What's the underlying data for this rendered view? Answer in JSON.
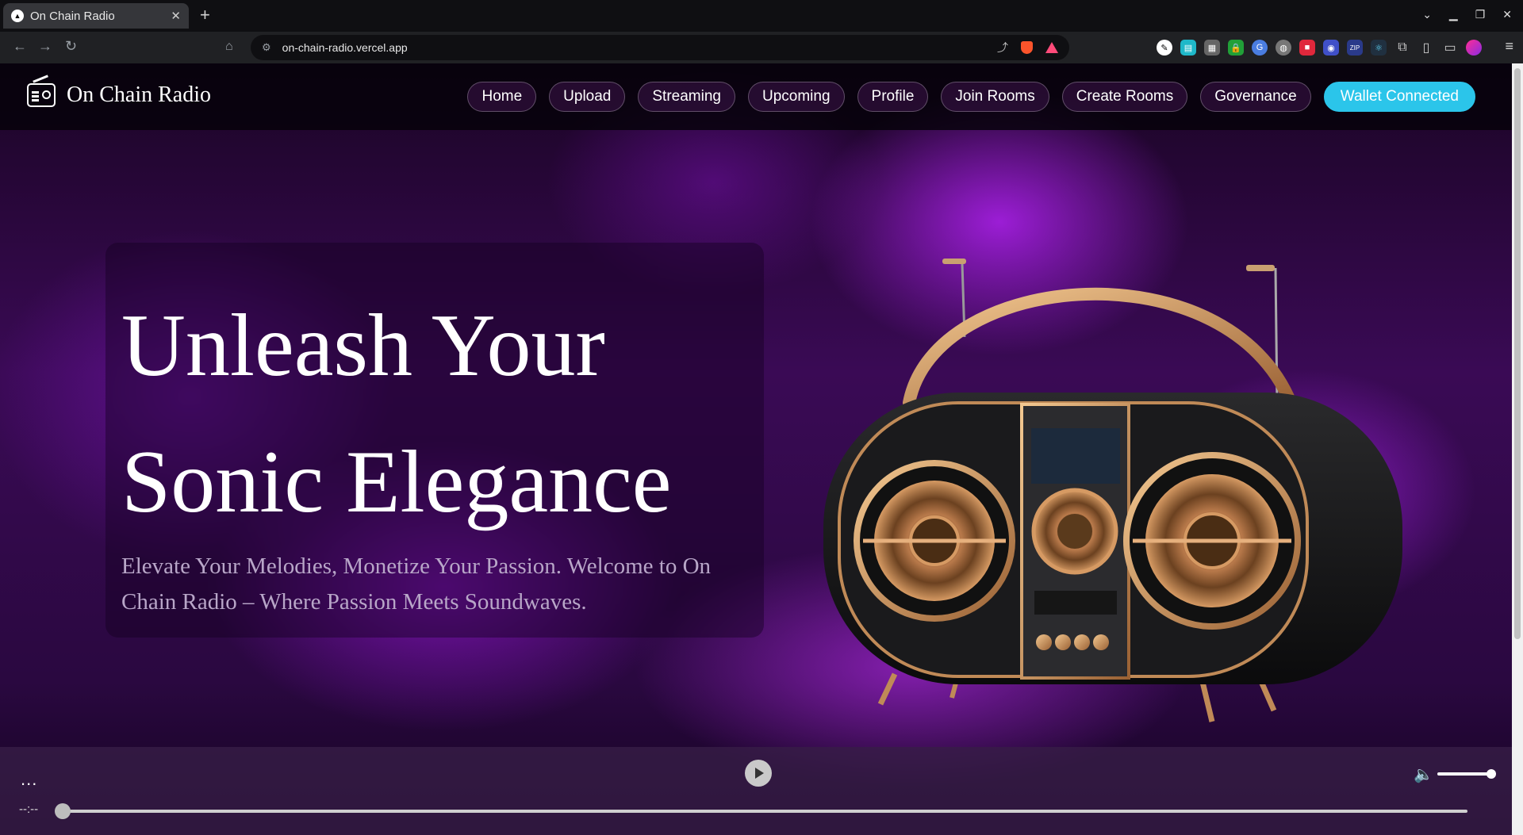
{
  "browser": {
    "tab_title": "On Chain Radio",
    "tab_close": "✕",
    "new_tab": "+",
    "url": "on-chain-radio.vercel.app"
  },
  "site": {
    "name": "On Chain Radio",
    "nav": [
      "Home",
      "Upload",
      "Streaming",
      "Upcoming",
      "Profile",
      "Join Rooms",
      "Create Rooms",
      "Governance"
    ],
    "wallet_label": "Wallet Connected"
  },
  "hero": {
    "headline_line1": "Unleash Your",
    "headline_line2": "Sonic Elegance",
    "subtext": "Elevate Your Melodies, Monetize Your Passion. Welcome to On Chain Radio – Where Passion Meets Soundwaves."
  },
  "player": {
    "track_title": "...",
    "time": "--:--",
    "progress": 0,
    "volume": 1
  },
  "colors": {
    "accent": "#2bc5ea",
    "purple_glow": "#a820e6"
  }
}
